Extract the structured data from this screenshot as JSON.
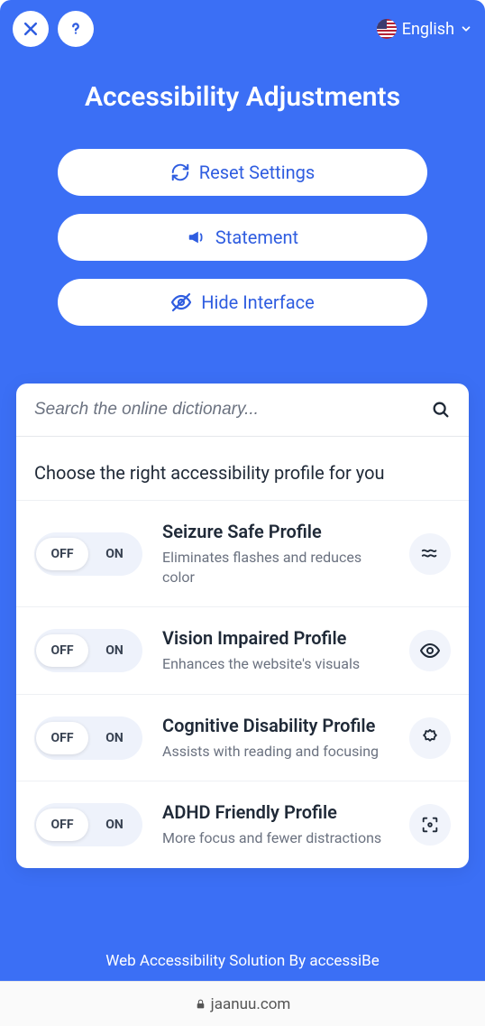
{
  "topbar": {
    "language_label": "English"
  },
  "hero": {
    "title": "Accessibility Adjustments",
    "reset_label": "Reset Settings",
    "statement_label": "Statement",
    "hide_label": "Hide Interface"
  },
  "search": {
    "placeholder": "Search the online dictionary..."
  },
  "panel": {
    "heading": "Choose the right accessibility profile for you"
  },
  "toggle": {
    "off": "OFF",
    "on": "ON"
  },
  "profiles": [
    {
      "title": "Seizure Safe Profile",
      "desc": "Eliminates flashes and reduces color"
    },
    {
      "title": "Vision Impaired Profile",
      "desc": "Enhances the website's visuals"
    },
    {
      "title": "Cognitive Disability Profile",
      "desc": "Assists with reading and focusing"
    },
    {
      "title": "ADHD Friendly Profile",
      "desc": "More focus and fewer distractions"
    }
  ],
  "footer": {
    "text": "Web Accessibility Solution By accessiBe"
  },
  "browser": {
    "domain": "jaanuu.com"
  }
}
